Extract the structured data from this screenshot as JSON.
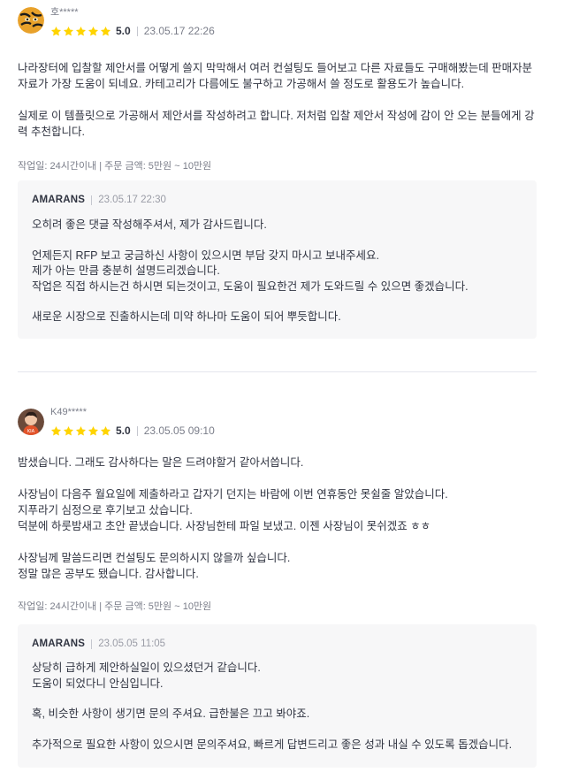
{
  "colors": {
    "star": "#ffd400",
    "text": "#303441",
    "muted": "#7a7d89",
    "reply_bg": "#f7f7f8"
  },
  "reviews": [
    {
      "user": "호*****",
      "score": "5.0",
      "stars": 5,
      "date": "23.05.17 22:26",
      "paragraphs": [
        "나라장터에 입찰할 제안서를 어떻게 쓸지 막막해서 여러 컨설팅도 들어보고 다른 자료들도 구매해봤는데 판매자분 자료가 가장 도움이 되네요. 카테고리가 다름에도 불구하고 가공해서 쓸 정도로 활용도가 높습니다.",
        "실제로 이 템플릿으로 가공해서 제안서를 작성하려고 합니다. 저처럼 입찰 제안서 작성에 감이 안 오는 분들에게 강력 추천합니다."
      ],
      "work_info": "작업일: 24시간이내 | 주문 금액: 5만원 ~ 10만원",
      "reply": {
        "seller": "AMARANS",
        "date": "23.05.17 22:30",
        "paragraphs": [
          "오히려 좋은 댓글 작성해주셔서, 제가 감사드립니다.",
          "언제든지 RFP 보고 궁금하신 사항이 있으시면 부담 갖지 마시고 보내주세요.\n제가 아는 만큼 충분히 설명드리겠습니다.\n작업은 직접 하시는건 하시면 되는것이고, 도움이 필요한건 제가 도와드릴 수 있으면 좋겠습니다.",
          "새로운 시장으로 진출하시는데 미약 하나마 도움이 되어 뿌듯합니다."
        ]
      }
    },
    {
      "user": "K49*****",
      "score": "5.0",
      "stars": 5,
      "date": "23.05.05 09:10",
      "paragraphs": [
        "밤샜습니다. 그래도 감사하다는 말은 드려야할거 같아서씁니다.",
        "사장님이 다음주 월요일에 제출하라고 갑자기 던지는 바람에 이번 연휴동안 못쉴줄 알았습니다.\n지푸라기 심정으로 후기보고 샀습니다.\n덕분에 하룻밤새고 초안 끝냈습니다. 사장님한테 파일 보냈고. 이젠 사장님이 못쉬겠죠 ㅎㅎ",
        "사장님께 말씀드리면 컨설팅도 문의하시지 않을까 싶습니다.\n정말 많은 공부도 됐습니다. 감사합니다."
      ],
      "work_info": "작업일: 24시간이내 | 주문 금액: 5만원 ~ 10만원",
      "reply": {
        "seller": "AMARANS",
        "date": "23.05.05 11:05",
        "paragraphs": [
          "상당히 급하게 제안하실일이 있으셨던거 같습니다.\n도움이 되었다니 안심입니다.",
          "혹, 비슷한 사항이 생기면 문의 주셔요. 급한불은 끄고 봐야죠.",
          "추가적으로 필요한 사항이 있으시면 문의주셔요, 빠르게 답변드리고 좋은 성과 내실 수 있도록 돕겠습니다."
        ]
      }
    }
  ]
}
